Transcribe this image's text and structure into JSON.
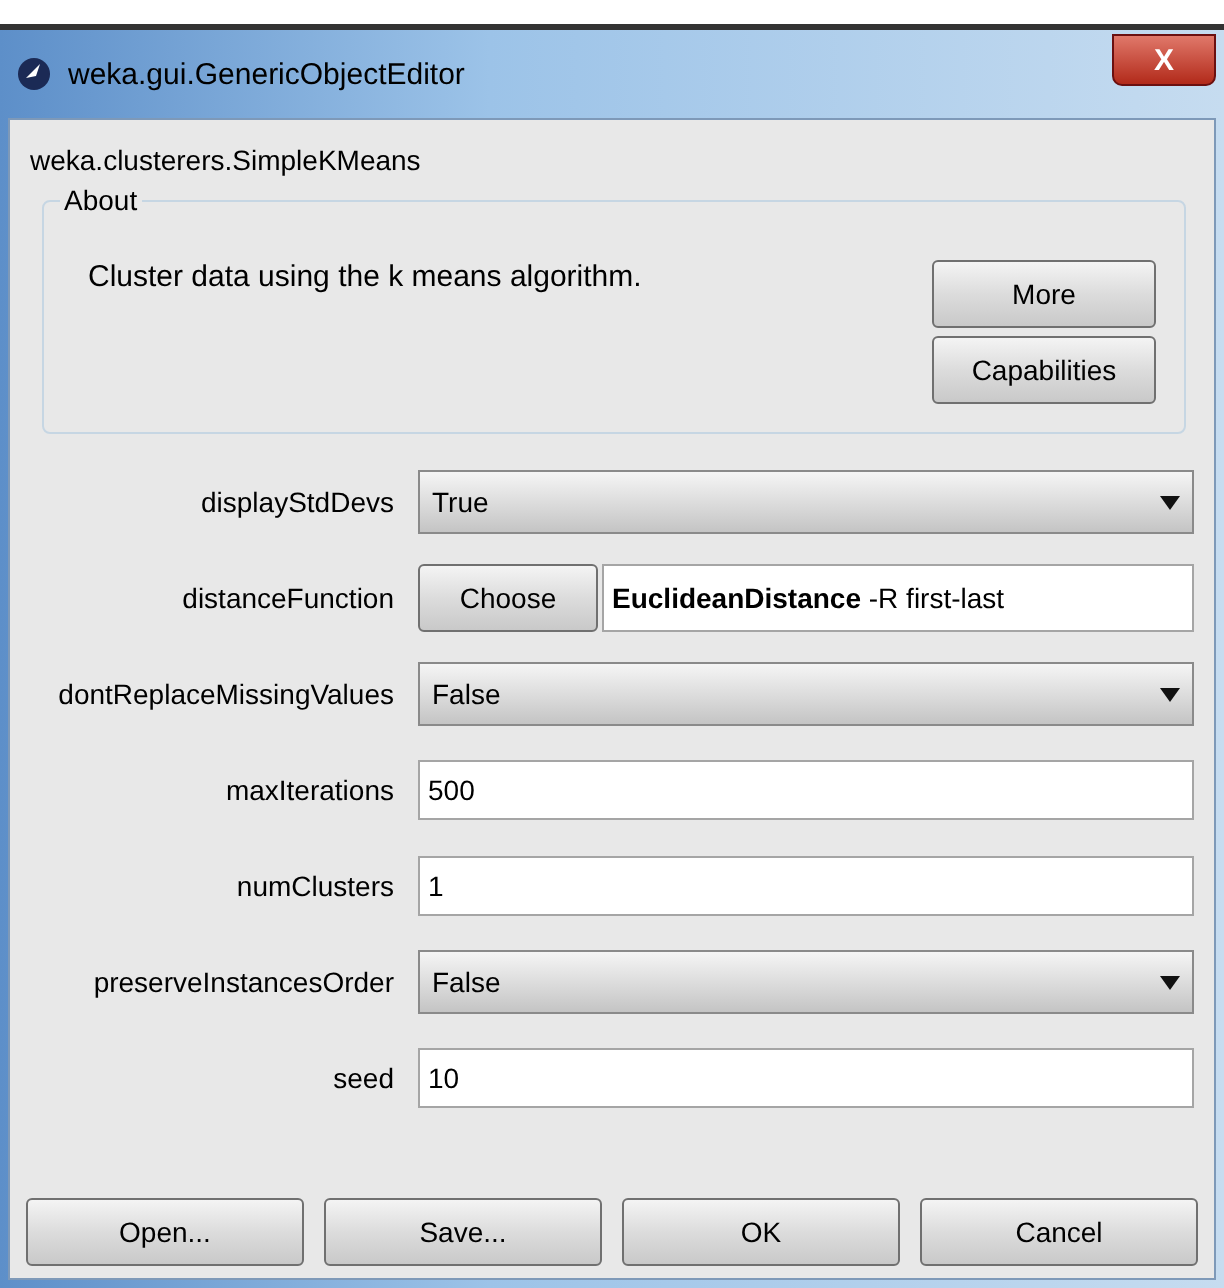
{
  "window": {
    "title": "weka.gui.GenericObjectEditor",
    "close": "X"
  },
  "class_name": "weka.clusterers.SimpleKMeans",
  "about": {
    "title": "About",
    "text": "Cluster data using the k means algorithm.",
    "buttons": [
      "More",
      "Capabilities"
    ]
  },
  "properties": [
    {
      "kind": "dropdown",
      "label": "displayStdDevs",
      "value": "True"
    },
    {
      "kind": "chooser",
      "label": "distanceFunction",
      "button": "Choose",
      "value": "**EuclideanDistance** -R first-last"
    },
    {
      "kind": "dropdown",
      "label": "dontReplaceMissingValues",
      "value": "False"
    },
    {
      "kind": "text",
      "label": "maxIterations",
      "value": "500"
    },
    {
      "kind": "text",
      "label": "numClusters",
      "value": "1"
    },
    {
      "kind": "dropdown",
      "label": "preserveInstancesOrder",
      "value": "False"
    },
    {
      "kind": "text",
      "label": "seed",
      "value": "10"
    }
  ],
  "buttons": [
    "Open...",
    "Save...",
    "OK",
    "Cancel"
  ]
}
